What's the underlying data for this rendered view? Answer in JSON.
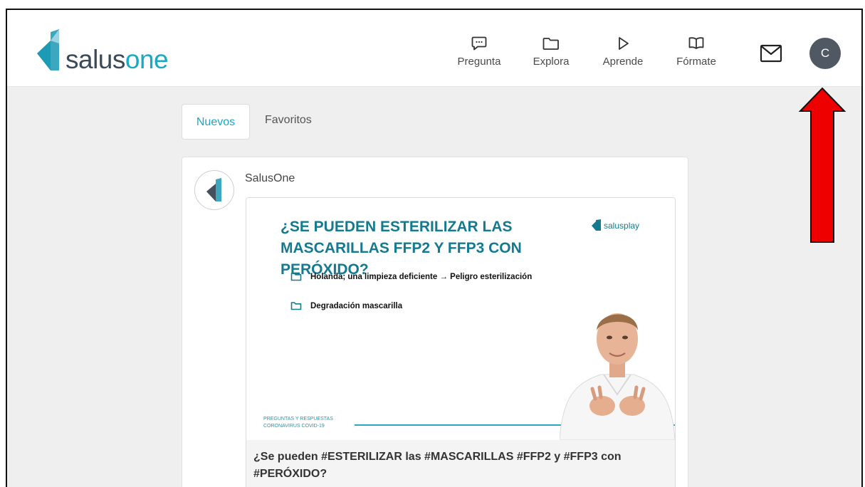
{
  "brand": {
    "name_prefix": "salus",
    "name_suffix": "one",
    "colors": {
      "accent": "#19a9c3",
      "dark": "#3c4a57"
    }
  },
  "nav": [
    {
      "label": "Pregunta",
      "icon": "chat-bubble-icon"
    },
    {
      "label": "Explora",
      "icon": "folder-icon"
    },
    {
      "label": "Aprende",
      "icon": "play-icon"
    },
    {
      "label": "Fórmate",
      "icon": "book-icon"
    }
  ],
  "messages_icon": "mail-icon",
  "user": {
    "initial": "C",
    "avatar_color": "#4f5863"
  },
  "tabs": [
    {
      "label": "Nuevos",
      "active": true
    },
    {
      "label": "Favoritos",
      "active": false
    }
  ],
  "post": {
    "author": "SalusOne",
    "slide": {
      "title": "¿SE PUEDEN ESTERILIZAR LAS MASCARILLAS FFP2 Y FFP3 CON PERÓXIDO?",
      "brand": "salusplay",
      "bullets": [
        "Holanda; una limpieza deficiente → Peligro esterilización",
        "Degradación mascarilla"
      ],
      "footer_line1": "PREGUNTAS Y RESPUESTAS",
      "footer_line2": "CORONAVIRUS COVID-19"
    },
    "caption": "¿Se pueden #ESTERILIZAR las #MASCARILLAS #FFP2 y #FFP3 con #PERÓXIDO?"
  },
  "annotation": {
    "color": "#ff0000",
    "points_to": "user-avatar"
  }
}
